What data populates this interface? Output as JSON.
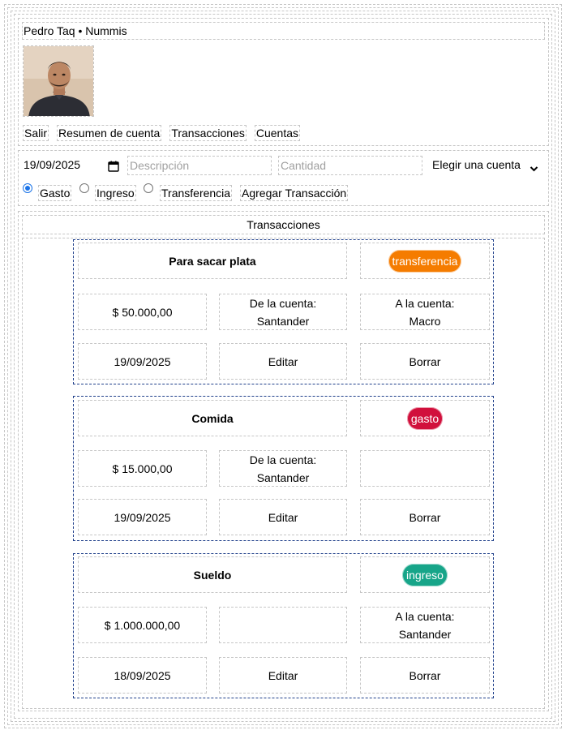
{
  "header": {
    "title": "Pedro Taq • Nummis",
    "nav": [
      "Salir",
      "Resumen de cuenta",
      "Transacciones",
      "Cuentas"
    ]
  },
  "form": {
    "date_value": "19/09/2025",
    "description_placeholder": "Descripción",
    "amount_placeholder": "Cantidad",
    "account_select_value": "Elegir una cuenta",
    "types": [
      "Gasto",
      "Ingreso",
      "Transferencia"
    ],
    "selected_type": "Gasto",
    "submit_label": "Agregar Transacción"
  },
  "transactions_title": "Transacciones",
  "transactions": [
    {
      "description": "Para sacar plata",
      "type": "transferencia",
      "amount": "$ 50.000,00",
      "from_label": "De la cuenta:",
      "from_account": "Santander",
      "to_label": "A la cuenta:",
      "to_account": "Macro",
      "date": "19/09/2025",
      "edit_label": "Editar",
      "delete_label": "Borrar"
    },
    {
      "description": "Comida",
      "type": "gasto",
      "amount": "$ 15.000,00",
      "from_label": "De la cuenta:",
      "from_account": "Santander",
      "to_label": "",
      "to_account": "",
      "date": "19/09/2025",
      "edit_label": "Editar",
      "delete_label": "Borrar"
    },
    {
      "description": "Sueldo",
      "type": "ingreso",
      "amount": "$ 1.000.000,00",
      "from_label": "",
      "from_account": "",
      "to_label": "A la cuenta:",
      "to_account": "Santander",
      "date": "18/09/2025",
      "edit_label": "Editar",
      "delete_label": "Borrar"
    }
  ],
  "colors": {
    "transferencia": "#f57c00",
    "gasto": "#d1103c",
    "ingreso": "#17a589",
    "card_border": "#1f3f8a",
    "radio_accent": "#1a73e8"
  },
  "icons": {
    "date_picker": "calendar-icon",
    "select_arrow": "chevron-down-icon",
    "avatar": "user-photo"
  }
}
